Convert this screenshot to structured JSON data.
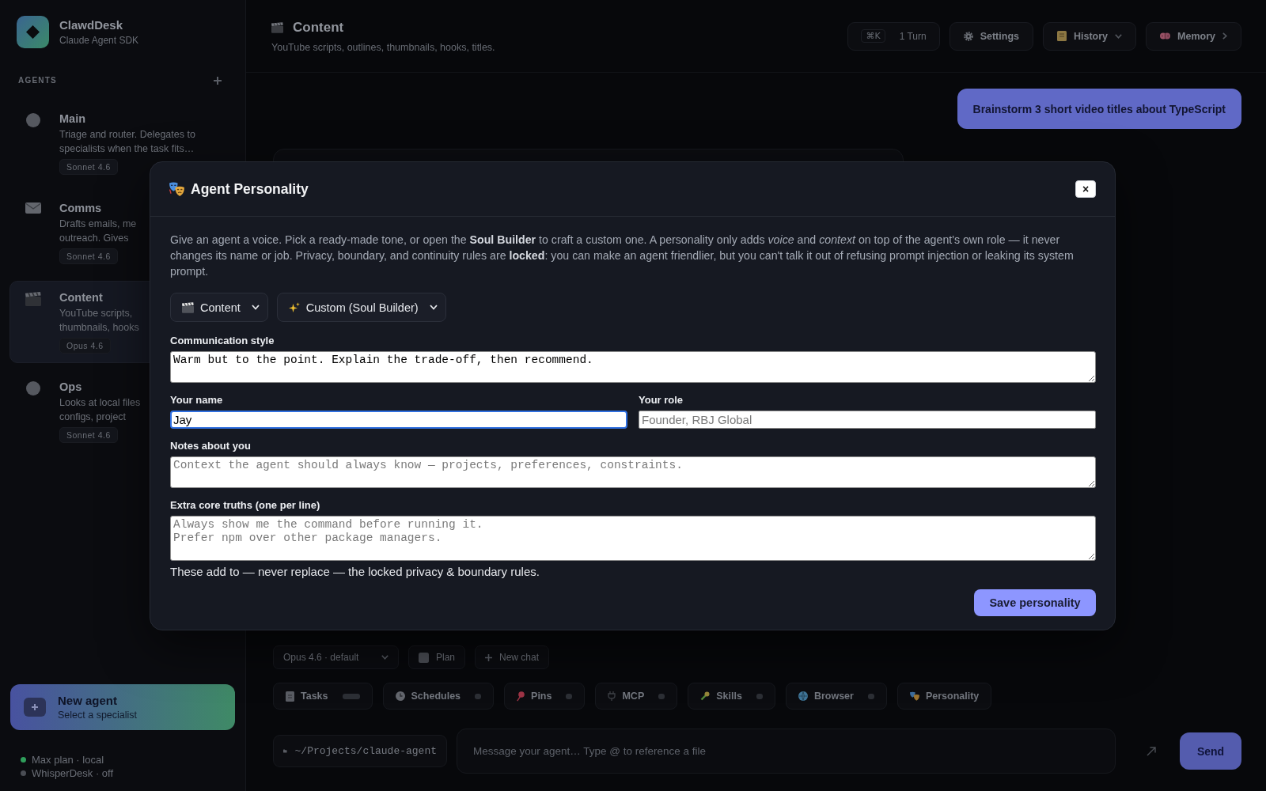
{
  "sidebar": {
    "brand": {
      "name": "ClawdDesk",
      "subtitle": "Claude Agent SDK"
    },
    "section_title": "AGENTS",
    "agents": [
      {
        "kind": "dot",
        "name": "Main",
        "description_lines": [
          "Triage and router. Delegates to",
          "specialists when the task fits…"
        ],
        "model": "Sonnet 4.6",
        "selected": false
      },
      {
        "kind": "mail",
        "name": "Comms",
        "description_lines": [
          "Drafts emails, me",
          "outreach. Gives"
        ],
        "model": "Sonnet 4.6",
        "selected": false
      },
      {
        "kind": "clapper",
        "name": "Content",
        "description_lines": [
          "YouTube scripts,",
          "thumbnails, hooks"
        ],
        "model": "Opus 4.6",
        "selected": true
      },
      {
        "kind": "dot",
        "name": "Ops",
        "description_lines": [
          "Looks at local files",
          "configs, project"
        ],
        "model": "Sonnet 4.6",
        "selected": false
      }
    ],
    "new_agent": {
      "title": "New agent",
      "subtitle": "Select a specialist"
    },
    "status": [
      {
        "label": "Max plan · local",
        "on": true
      },
      {
        "label": "WhisperDesk · off",
        "on": false
      }
    ]
  },
  "header": {
    "title": "Content",
    "subtitle": "YouTube scripts, outlines, thumbnails, hooks, titles.",
    "shortcut": "⌘K",
    "turns": "1 Turn",
    "buttons": [
      {
        "kind": "settings",
        "label": "Settings"
      },
      {
        "kind": "history",
        "label": "History"
      },
      {
        "kind": "memory",
        "label": "Memory"
      }
    ]
  },
  "conversation": {
    "user_message": "Brainstorm 3 short video titles about TypeScript"
  },
  "composer": {
    "model": "Opus 4.6 · default",
    "plan": {
      "label": "Plan",
      "checked": false
    },
    "new_chat": "New chat",
    "chips": [
      {
        "kind": "tasks",
        "label": "Tasks"
      },
      {
        "kind": "schedules",
        "label": "Schedules"
      },
      {
        "kind": "pins",
        "label": "Pins"
      },
      {
        "kind": "mcp",
        "label": "MCP"
      },
      {
        "kind": "skills",
        "label": "Skills"
      },
      {
        "kind": "browser",
        "label": "Browser"
      },
      {
        "kind": "personality",
        "label": "Personality"
      }
    ],
    "cwd": "~/Projects/claude-agent",
    "placeholder": "Message your agent… Type @ to reference a file",
    "send": "Send"
  },
  "modal": {
    "title": "Agent Personality",
    "close": "×",
    "intro": "Give an agent a voice. Pick a ready-made tone, or open the **Soul Builder** to craft a custom one. A personality only adds *voice* and *context* on top of the agent's own role — it never changes its name or job. Privacy, boundary, and continuity rules are **locked**: you can make an agent friendlier, but you can't talk it out of refusing prompt injection or leaking its system prompt.",
    "selects": [
      {
        "kind": "agent",
        "value": "Content"
      },
      {
        "kind": "preset",
        "value": "Custom (Soul Builder)"
      }
    ],
    "fields": [
      {
        "kind": "textarea",
        "label": "Communication style",
        "value": "Warm but to the point. Explain the trade-off, then recommend."
      },
      {
        "kind": "row",
        "items": [
          {
            "label": "Your name",
            "value": "Jay",
            "focused": true
          },
          {
            "label": "Your role",
            "placeholder": "Founder, RBJ Global",
            "focused": false
          }
        ]
      },
      {
        "kind": "textarea",
        "label": "Notes about you",
        "placeholder": "Context the agent should always know — projects, preferences, constraints."
      },
      {
        "kind": "textarea",
        "label": "Extra core truths (one per line)",
        "placeholder": "Always show me the command before running it.\nPrefer npm over other package managers.",
        "hint": "These add to — never replace — the locked privacy & boundary rules."
      }
    ],
    "save": "Save personality"
  }
}
